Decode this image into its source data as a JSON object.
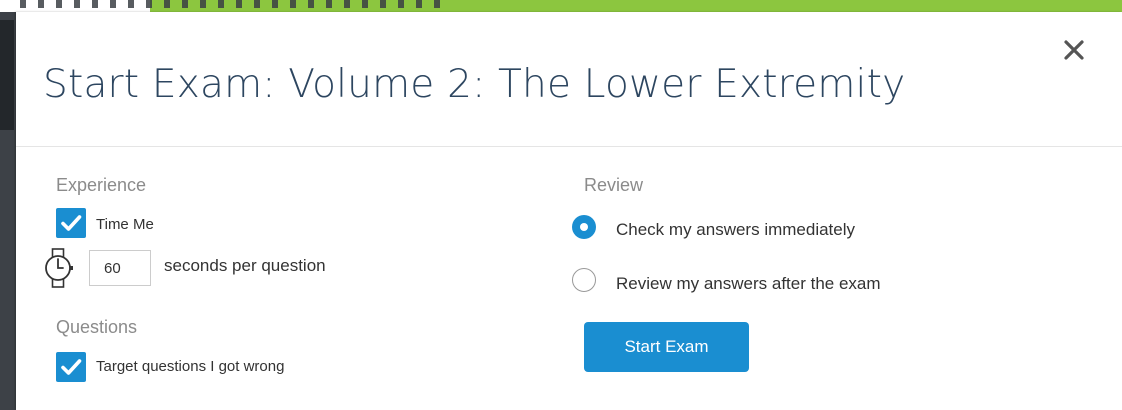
{
  "modal": {
    "title": "Start Exam: Volume 2: The Lower Extremity",
    "close_icon": "close-icon"
  },
  "experience": {
    "heading": "Experience",
    "time_me": {
      "label": "Time Me",
      "checked": true
    },
    "seconds": {
      "value": "60",
      "label": "seconds per question",
      "icon": "stopwatch-icon"
    }
  },
  "questions": {
    "heading": "Questions",
    "target_wrong": {
      "label": "Target questions I got wrong",
      "checked": true
    }
  },
  "review": {
    "heading": "Review",
    "options": [
      {
        "label": "Check my answers immediately",
        "selected": true
      },
      {
        "label": "Review my answers after the exam",
        "selected": false
      }
    ]
  },
  "actions": {
    "start_label": "Start Exam"
  },
  "colors": {
    "accent": "#1a8ed1",
    "title": "#2d4660",
    "muted": "#8b8b8b",
    "top_bar": "#8cc63f"
  }
}
